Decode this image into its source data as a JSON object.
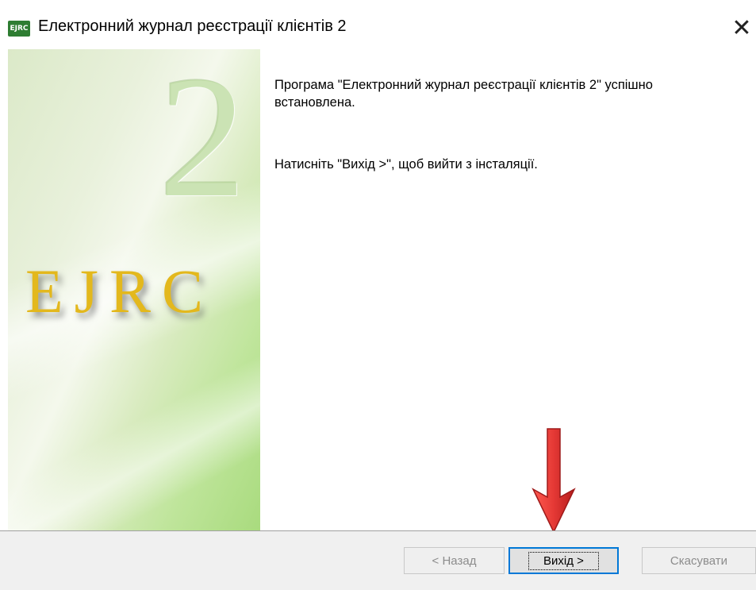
{
  "window": {
    "title": "Електронний журнал реєстрації клієнтів 2",
    "icon_label": "EJRC",
    "close_glyph": "✕"
  },
  "sidebar": {
    "version_digit": "2",
    "brand": "EJRC"
  },
  "content": {
    "message_line1": "Програма \"Електронний журнал реєстрації клієнтів 2\" успішно встановлена.",
    "message_line2": "Натисніть \"Вихід >\", щоб вийти з інсталяції."
  },
  "annotation": {
    "icon": "arrow-down-icon",
    "color": "#e53935"
  },
  "buttons": {
    "back": "< Назад",
    "exit": "Вихід >",
    "cancel": "Скасувати"
  }
}
